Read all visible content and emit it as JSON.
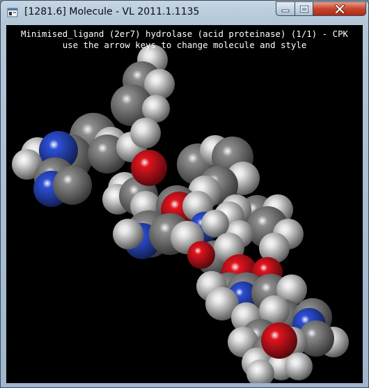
{
  "window": {
    "title": "[1281.6] Molecule - VL 2011.1.1135",
    "icon": "molecule-app-icon",
    "buttons": {
      "minimize": "minimize-icon",
      "maximize": "maximize-icon",
      "close": "close-icon"
    }
  },
  "viewer": {
    "line1": "Minimised_ligand (2er7) hydrolase (acid proteinase) (1/1) - CPK",
    "line2": "use the arrow keys to change molecule and style",
    "background": "#000000",
    "atom_colors": {
      "carbon": "#8c8c8c",
      "hydrogen": "#e8e8e8",
      "oxygen": "#e0141e",
      "nitrogen": "#2d4fd6"
    }
  }
}
